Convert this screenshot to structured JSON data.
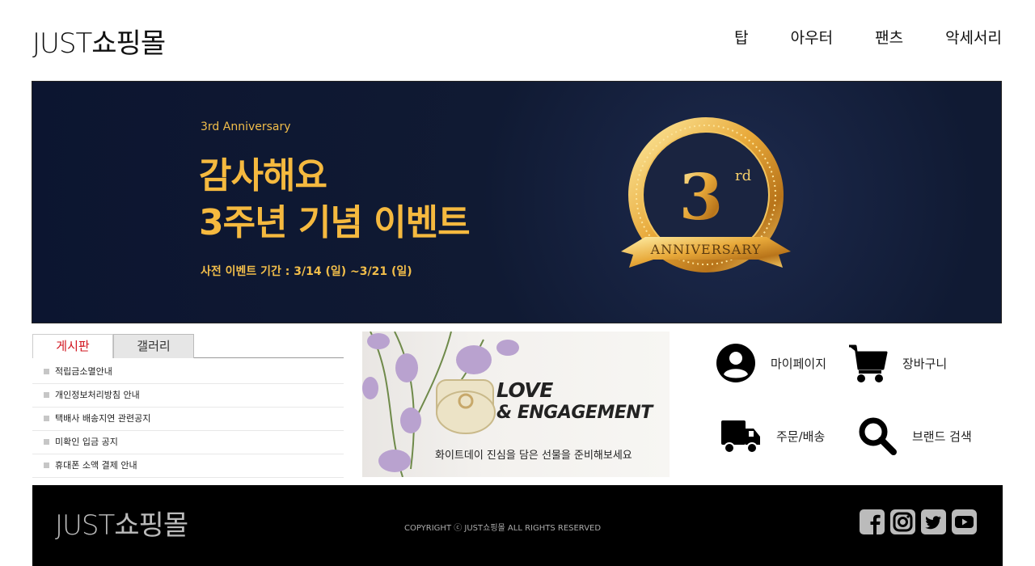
{
  "header": {
    "logo": "JUST쇼핑몰",
    "nav": [
      "탑",
      "아우터",
      "팬츠",
      "악세서리"
    ]
  },
  "banner": {
    "subtitle": "3rd Anniversary",
    "title_line1": "감사해요",
    "title_line2": "3주년 기념 이벤트",
    "date": "사전 이벤트 기간 : 3/14 (일) ~3/21 (일)",
    "badge_number": "3",
    "badge_suffix": "rd",
    "badge_ribbon": "ANNIVERSARY"
  },
  "board": {
    "tabs": [
      "게시판",
      "갤러리"
    ],
    "items": [
      "적립금소멸안내",
      "개인정보처리방침 안내",
      "택배사 배송지연 관련공지",
      "미확인 입금 공지",
      "휴대폰 소액 결제 안내"
    ]
  },
  "promo": {
    "line1": "LOVE",
    "line2": "& ENGAGEMENT",
    "caption": "화이트데이  진심을 담은 선물을 준비해보세요"
  },
  "quick": {
    "mypage": "마이페이지",
    "cart": "장바구니",
    "order": "주문/배송",
    "brand_search": "브랜드 검색"
  },
  "footer": {
    "logo": "JUST쇼핑몰",
    "copyright": "COPYRIGHT ⓒ JUST쇼핑몰 ALL RIGHTS RESERVED"
  },
  "colors": {
    "banner_gold": "#f5b93f",
    "banner_bg": "#0c1530",
    "tab_active": "#d1141e",
    "footer_bg": "#000000"
  }
}
